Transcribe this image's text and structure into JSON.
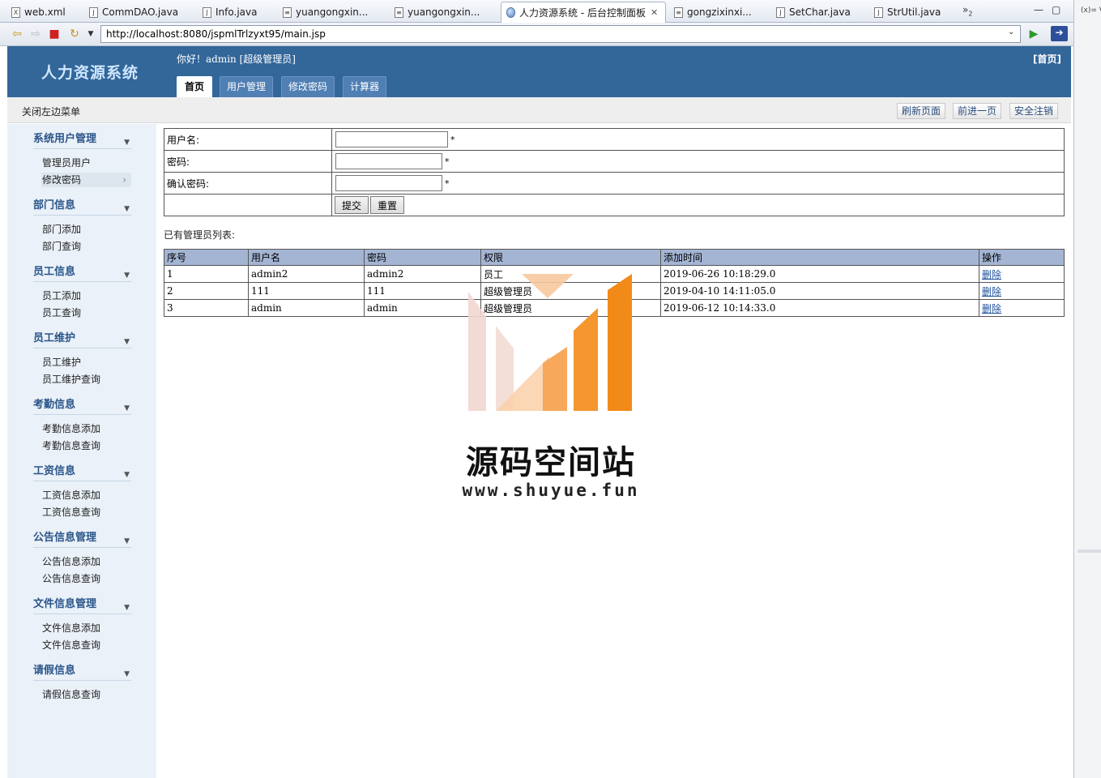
{
  "ide": {
    "tabs": [
      {
        "label": "web.xml",
        "icon": "xml-file-icon"
      },
      {
        "label": "CommDAO.java",
        "icon": "java-file-icon"
      },
      {
        "label": "Info.java",
        "icon": "java-file-icon"
      },
      {
        "label": "yuangongxin...",
        "icon": "jsp-file-icon"
      },
      {
        "label": "yuangongxin...",
        "icon": "jsp-file-icon"
      },
      {
        "label": "人力资源系统 - 后台控制面板",
        "icon": "browser-globe-icon",
        "active": true
      },
      {
        "label": "gongzixinxi...",
        "icon": "jsp-file-icon"
      },
      {
        "label": "SetChar.java",
        "icon": "java-file-icon"
      },
      {
        "label": "StrUtil.java",
        "icon": "java-file-icon"
      }
    ],
    "overflow_count": "2",
    "side_panel_label": "(x)= V"
  },
  "browser": {
    "url": "http://localhost:8080/jspmlTrlzyxt95/main.jsp"
  },
  "header": {
    "logo": "人力资源系统",
    "greeting": "你好！admin [超级管理员]",
    "home_link": "[首页]",
    "tabs": [
      "首页",
      "用户管理",
      "修改密码",
      "计算器"
    ]
  },
  "subbar": {
    "toggle_menu": "关闭左边菜单",
    "refresh": "刷新页面",
    "forward": "前进一页",
    "logout": "安全注销"
  },
  "menu": [
    {
      "title": "系统用户管理",
      "items": [
        "管理员用户",
        "修改密码"
      ]
    },
    {
      "title": "部门信息",
      "items": [
        "部门添加",
        "部门查询"
      ]
    },
    {
      "title": "员工信息",
      "items": [
        "员工添加",
        "员工查询"
      ]
    },
    {
      "title": "员工维护",
      "items": [
        "员工维护",
        "员工维护查询"
      ]
    },
    {
      "title": "考勤信息",
      "items": [
        "考勤信息添加",
        "考勤信息查询"
      ]
    },
    {
      "title": "工资信息",
      "items": [
        "工资信息添加",
        "工资信息查询"
      ]
    },
    {
      "title": "公告信息管理",
      "items": [
        "公告信息添加",
        "公告信息查询"
      ]
    },
    {
      "title": "文件信息管理",
      "items": [
        "文件信息添加",
        "文件信息查询"
      ]
    },
    {
      "title": "请假信息",
      "items": [
        "请假信息查询"
      ]
    }
  ],
  "form": {
    "username_label": "用户名:",
    "password_label": "密码:",
    "confirm_label": "确认密码:",
    "required_mark": "*",
    "submit": "提交",
    "reset": "重置"
  },
  "list": {
    "caption": "已有管理员列表:",
    "columns": [
      "序号",
      "用户名",
      "密码",
      "权限",
      "添加时间",
      "操作"
    ],
    "rows": [
      [
        "1",
        "admin2",
        "admin2",
        "员工",
        "2019-06-26 10:18:29.0",
        "删除"
      ],
      [
        "2",
        "111",
        "111",
        "超级管理员",
        "2019-04-10 14:11:05.0",
        "删除"
      ],
      [
        "3",
        "admin",
        "admin",
        "超级管理员",
        "2019-06-12 10:14:33.0",
        "删除"
      ]
    ]
  },
  "watermark": {
    "text": "源码空间站",
    "url": "www.shuyue.fun"
  },
  "colors": {
    "header_bg": "#336699",
    "sidebar_bg": "#eaf1f8",
    "table_header_bg": "#a4b5d4",
    "watermark_orange": "#f28a1a"
  }
}
